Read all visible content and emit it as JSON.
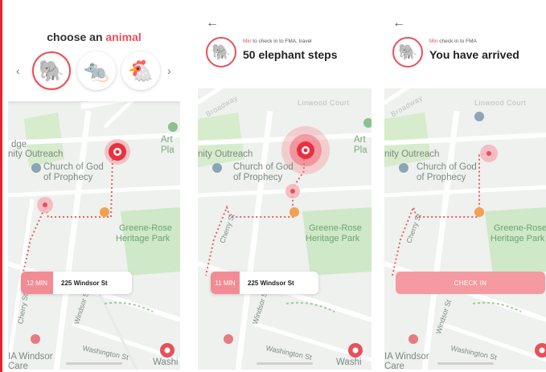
{
  "screen1": {
    "title_prefix": "choose an ",
    "title_accent": "animal",
    "animals": [
      "elephant-icon",
      "mouse-icon",
      "chicken-icon"
    ],
    "prev_icon": "chevron-left-icon",
    "next_icon": "chevron-right-icon",
    "eta": "12 MIN",
    "address": "225 Windsor St"
  },
  "screen2": {
    "sub_red": "Min",
    "sub_text": " to check in to FMA, travel",
    "headline": "50 elephant steps",
    "eta": "11 MIN",
    "address": "225 Windsor St"
  },
  "screen3": {
    "sub_red": "Min",
    "sub_text": " check in to FMA",
    "headline": "You have arrived",
    "checkin_label": "CHECK IN"
  },
  "map_labels": {
    "linwood": "Linwood Court",
    "broadway": "Broadway",
    "outreach_1": "dge",
    "outreach_2": "nity Outreach",
    "church_1": "Church of God",
    "church_2": "of Prophecy",
    "art_1": "Art",
    "art_2": "Pla",
    "park_1": "Greene-Rose",
    "park_2": "Heritage Park",
    "cherry": "Cherry St",
    "windsor": "Windsor St",
    "washington": "Washington St",
    "washi": "Washi",
    "fma_1": "IA Windsor",
    "fma_2": "Care"
  },
  "colors": {
    "accent": "#e8505b",
    "route": "#e8606a",
    "park": "#cfe8c8"
  }
}
